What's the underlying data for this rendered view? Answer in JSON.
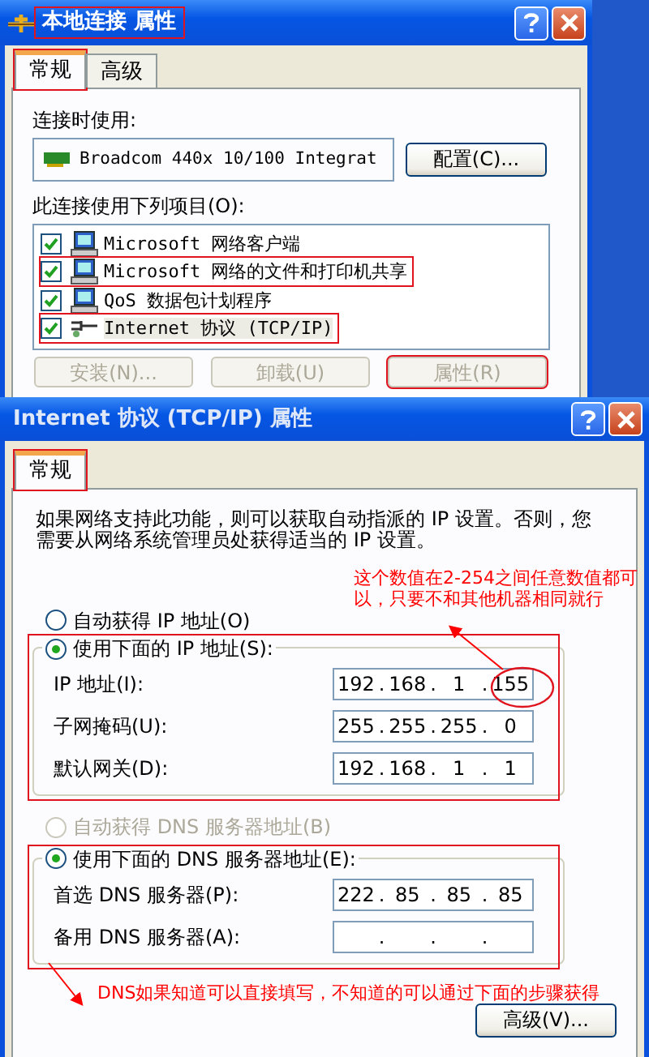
{
  "connection_dialog": {
    "title": "本地连接 属性",
    "title_highlighted": true,
    "tabs": [
      {
        "label": "常规",
        "selected": true,
        "highlighted": true
      },
      {
        "label": "高级",
        "selected": false,
        "highlighted": false
      }
    ],
    "connect_using_label": "连接时使用:",
    "adapter": "Broadcom 440x 10/100 Integrat",
    "configure_button": "配置(C)...",
    "components_label": "此连接使用下列项目(O):",
    "components": [
      {
        "kind": "computer",
        "label": "Microsoft 网络客户端",
        "checked": true,
        "selected": false,
        "highlighted": false
      },
      {
        "kind": "computer",
        "label": "Microsoft 网络的文件和打印机共享",
        "checked": true,
        "selected": false,
        "highlighted": true
      },
      {
        "kind": "computer",
        "label": "QoS 数据包计划程序",
        "checked": true,
        "selected": false,
        "highlighted": false
      },
      {
        "kind": "protocol",
        "label": "Internet 协议 (TCP/IP)",
        "checked": true,
        "selected": true,
        "highlighted": true
      }
    ],
    "buttons": [
      {
        "label": "安装(N)...",
        "disabled": true,
        "highlighted": false
      },
      {
        "label": "卸载(U)",
        "disabled": true,
        "highlighted": false
      },
      {
        "label": "属性(R)",
        "disabled": true,
        "highlighted": true
      }
    ]
  },
  "tcpip_dialog": {
    "title": "Internet 协议 (TCP/IP) 属性",
    "tabs": [
      {
        "label": "常规",
        "selected": true,
        "highlighted": true
      }
    ],
    "description": "如果网络支持此功能，则可以获取自动指派的 IP 设置。否则，您需要从网络系统管理员处获得适当的 IP 设置。",
    "separator": ".",
    "ip_groups": [
      {
        "options": [
          {
            "label": "自动获得 IP 地址(O)",
            "selected": false,
            "disabled": false
          },
          {
            "label": "使用下面的 IP 地址(S):",
            "selected": true,
            "disabled": false
          }
        ],
        "highlighted": true,
        "fields": [
          {
            "label": "IP 地址(I):",
            "octets": [
              "192",
              "168",
              "1",
              "155"
            ]
          },
          {
            "label": "子网掩码(U):",
            "octets": [
              "255",
              "255",
              "255",
              "0"
            ]
          },
          {
            "label": "默认网关(D):",
            "octets": [
              "192",
              "168",
              "1",
              "1"
            ]
          }
        ]
      },
      {
        "options": [
          {
            "label": "自动获得 DNS 服务器地址(B)",
            "selected": false,
            "disabled": true
          },
          {
            "label": "使用下面的 DNS 服务器地址(E):",
            "selected": true,
            "disabled": false
          }
        ],
        "highlighted": true,
        "fields": [
          {
            "label": "首选 DNS 服务器(P):",
            "octets": [
              "222",
              "85",
              "85",
              "85"
            ]
          },
          {
            "label": "备用 DNS 服务器(A):"
          }
        ]
      }
    ],
    "advanced_button": "高级(V)...",
    "annotations": [
      {
        "text": "这个数值在2-254之间任意数值都可以，只要不和其他机器相同就行"
      },
      {
        "text": "DNS如果知道可以直接填写，不知道的可以通过下面的步骤获得"
      }
    ]
  }
}
